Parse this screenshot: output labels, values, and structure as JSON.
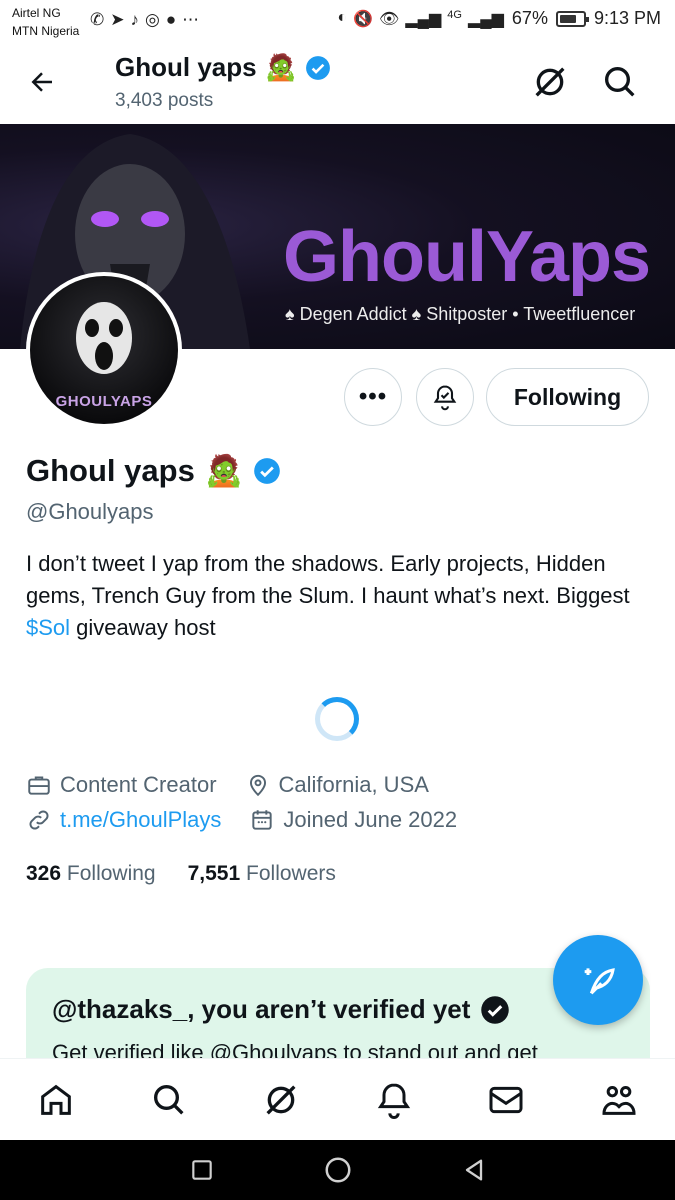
{
  "status_bar": {
    "carrier1": "Airtel NG",
    "carrier2": "MTN Nigeria",
    "app_icons": [
      "whatsapp-icon",
      "telegram-icon",
      "tiktok-icon",
      "instagram-icon",
      "message-icon",
      "more-icon"
    ],
    "network": "4G",
    "battery": "67%",
    "battery_level": 0.67,
    "time": "9:13 PM"
  },
  "header": {
    "title": "Ghoul yaps",
    "posts": "3,403 posts"
  },
  "banner": {
    "title": "GhoulYaps",
    "tagline": "♠ Degen Addict ♠ Shitposter • Tweetfluencer"
  },
  "avatar": {
    "text": "GHOULYAPS"
  },
  "actions": {
    "more_label": "•••",
    "following_label": "Following"
  },
  "profile": {
    "name": "Ghoul yaps",
    "emoji": "🧟",
    "handle": "@Ghoulyaps",
    "bio_before": "I don’t tweet I yap from the shadows. Early projects, Hidden gems, Trench Guy from the Slum. I haunt what’s next. Biggest ",
    "bio_tag": "$Sol",
    "bio_after": " giveaway host",
    "category": "Content Creator",
    "location": "California, USA",
    "link": "t.me/GhoulPlays",
    "joined": "Joined June 2022",
    "following_count": "326",
    "following_label": "Following",
    "followers_count": "7,551",
    "followers_label": "Followers"
  },
  "verify_card": {
    "title": "@thazaks_, you aren’t verified yet",
    "subtitle": "Get verified like @Ghoulyaps to stand out and get"
  },
  "colors": {
    "accent": "#1d9bf0",
    "banner_text": "#9b5ad6",
    "verify_bg": "#dff6ea"
  }
}
